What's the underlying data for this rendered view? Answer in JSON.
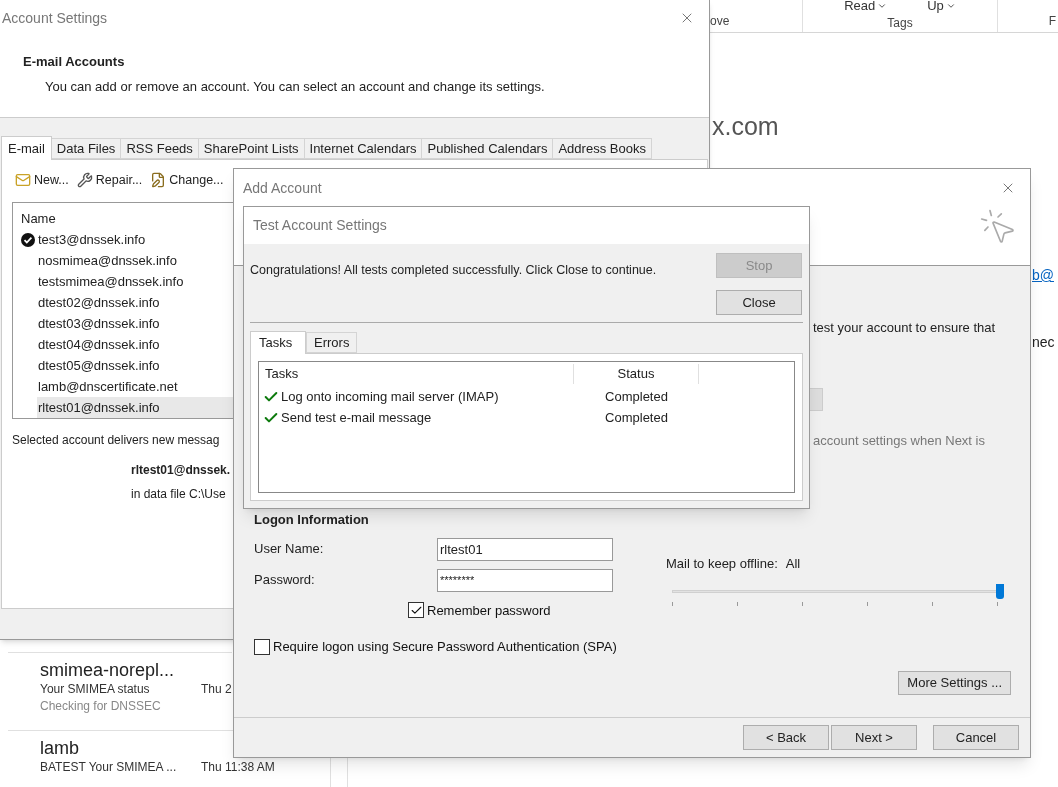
{
  "outlook": {
    "ribbon_buttons": [
      {
        "label": "Read"
      },
      {
        "label": "Up"
      }
    ],
    "ribbon_groups": [
      "ove",
      "Tags",
      "F"
    ],
    "heading": "x.com",
    "link": "b@",
    "text_fragment": "nec",
    "messages": [
      {
        "sender": "smimea-norepl...",
        "subject": "Your SMIMEA status",
        "date": "Thu 2",
        "preview": "Checking for DNSSEC"
      },
      {
        "sender": "lamb",
        "subject": "BATEST Your SMIMEA ...",
        "date": "Thu 11:38 AM"
      }
    ]
  },
  "account_settings": {
    "title": "Account Settings",
    "header_title": "E-mail Accounts",
    "header_text": "You can add or remove an account. You can select an account and change its settings.",
    "tabs": [
      {
        "label": "E-mail",
        "selected": true
      },
      {
        "label": "Data Files",
        "selected": false
      },
      {
        "label": "RSS Feeds",
        "selected": false
      },
      {
        "label": "SharePoint Lists",
        "selected": false
      },
      {
        "label": "Internet Calendars",
        "selected": false
      },
      {
        "label": "Published Calendars",
        "selected": false
      },
      {
        "label": "Address Books",
        "selected": false
      }
    ],
    "toolbar": [
      {
        "kind": "new",
        "label": "New..."
      },
      {
        "kind": "repair",
        "label": "Repair..."
      },
      {
        "kind": "change",
        "label": "Change..."
      }
    ],
    "list_column": "Name",
    "accounts": [
      {
        "name": "test3@dnssek.info",
        "default": true,
        "selected": false
      },
      {
        "name": "nosmimea@dnssek.info",
        "default": false,
        "selected": false
      },
      {
        "name": "testsmimea@dnssek.info",
        "default": false,
        "selected": false
      },
      {
        "name": "dtest02@dnssek.info",
        "default": false,
        "selected": false
      },
      {
        "name": "dtest03@dnssek.info",
        "default": false,
        "selected": false
      },
      {
        "name": "dtest04@dnssek.info",
        "default": false,
        "selected": false
      },
      {
        "name": "dtest05@dnssek.info",
        "default": false,
        "selected": false
      },
      {
        "name": "lamb@dnscertificate.net",
        "default": false,
        "selected": false
      },
      {
        "name": "rltest01@dnssek.info",
        "default": false,
        "selected": true
      }
    ],
    "delivery_text": "Selected account delivers new messag",
    "delivery_account": "rltest01@dnssek.",
    "delivery_file": "in data file C:\\Use"
  },
  "add_account": {
    "title": "Add Account",
    "partial_text": "test your account to ensure that",
    "partial_hint": "account settings when Next is",
    "section_title": "Logon Information",
    "user_name": {
      "label": "User Name:",
      "value": "rltest01"
    },
    "password": {
      "label": "Password:",
      "value": "********"
    },
    "remember_password": {
      "label": "Remember password",
      "checked": true
    },
    "spa": {
      "label": "Require logon using Secure Password Authentication (SPA)",
      "checked": false
    },
    "offline": {
      "label": "Mail to keep offline:",
      "value": "All",
      "level": 1
    },
    "more_settings": "More Settings ...",
    "buttons": [
      "< Back",
      "Next >",
      "Cancel"
    ]
  },
  "test_dialog": {
    "title": "Test Account Settings",
    "message": "Congratulations! All tests completed successfully. Click Close to continue.",
    "buttons": [
      {
        "label": "Stop",
        "disabled": true
      },
      {
        "label": "Close",
        "disabled": false
      }
    ],
    "tabs": [
      {
        "label": "Tasks",
        "selected": true
      },
      {
        "label": "Errors",
        "selected": false
      }
    ],
    "columns": [
      "Tasks",
      "Status"
    ],
    "tasks": [
      {
        "task": "Log onto incoming mail server (IMAP)",
        "status": "Completed",
        "done": true
      },
      {
        "task": "Send test e-mail message",
        "status": "Completed",
        "done": true
      }
    ]
  }
}
